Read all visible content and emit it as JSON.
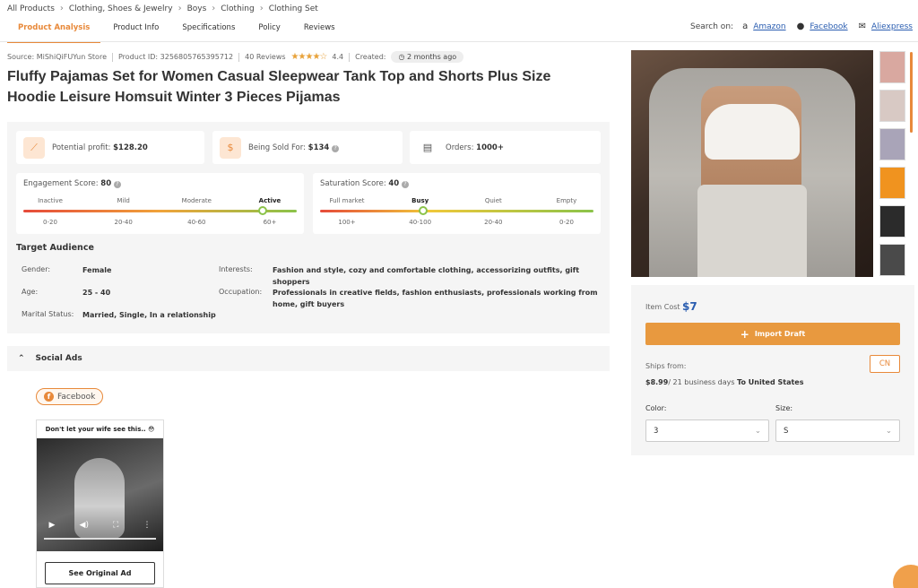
{
  "breadcrumb": [
    "All Products",
    "Clothing, Shoes & Jewelry",
    "Boys",
    "Clothing",
    "Clothing Set"
  ],
  "tabs": [
    "Product Analysis",
    "Product Info",
    "Specifications",
    "Policy",
    "Reviews"
  ],
  "search_on": {
    "label": "Search on:",
    "links": [
      "Amazon",
      "Facebook",
      "Aliexpress"
    ]
  },
  "meta": {
    "source": "Source: MiShiQiFUYun Store",
    "product_id": "Product ID: 3256805765395712",
    "reviews": "40 Reviews",
    "rating": "4.4",
    "rating_value": 4.4,
    "created_label": "Created:",
    "created_value": "2 months ago"
  },
  "title": "Fluffy Pajamas Set for Women Casual Sleepwear Tank Top and Shorts Plus Size Hoodie Leisure Homsuit Winter 3 Pieces Pijamas",
  "metrics": {
    "profit_label": "Potential profit:",
    "profit_value": "$128.20",
    "sold_label": "Being Sold For:",
    "sold_value": "$134",
    "orders_label": "Orders:",
    "orders_value": "1000+"
  },
  "engagement": {
    "label": "Engagement Score:",
    "value": "80",
    "score": 80,
    "levels": [
      "Inactive",
      "Mild",
      "Moderate",
      "Active"
    ],
    "ranges": [
      "0-20",
      "20-40",
      "40-60",
      "60+"
    ],
    "active_index": 3
  },
  "saturation": {
    "label": "Saturation Score:",
    "value": "40",
    "score": 40,
    "levels": [
      "Full market",
      "Busy",
      "Quiet",
      "Empty"
    ],
    "ranges": [
      "100+",
      "40-100",
      "20-40",
      "0-20"
    ],
    "active_index": 1
  },
  "audience": {
    "title": "Target Audience",
    "gender_label": "Gender:",
    "gender": "Female",
    "age_label": "Age:",
    "age": "25 - 40",
    "marital_label": "Marital Status:",
    "marital": "Married, Single, In a relationship",
    "interests_label": "Interests:",
    "interests": "Fashion and style, cozy and comfortable clothing, accessorizing outfits, gift shoppers",
    "occupation_label": "Occupation:",
    "occupation": "Professionals in creative fields, fashion enthusiasts, professionals working from home, gift buyers"
  },
  "social": {
    "title": "Social Ads",
    "platform": "Facebook",
    "ad_caption": "Don't let your wife see this.. 😳",
    "see_original": "See Original Ad"
  },
  "side": {
    "item_cost_label": "Item Cost",
    "item_cost": "$7",
    "import_btn": "Import Draft",
    "ships_from_label": "Ships from:",
    "cn": "CN",
    "ship_price": "$8.99",
    "ship_days": "/ 21 business days",
    "ship_to": "To United States",
    "color_label": "Color:",
    "color_value": "3",
    "size_label": "Size:",
    "size_value": "S"
  },
  "colors": {
    "accent": "#e8893a",
    "link": "#2a5db0"
  },
  "thumbnails": [
    {
      "color": "#d9a8a0"
    },
    {
      "color": "#d8c9c4"
    },
    {
      "color": "#a9a4b8"
    },
    {
      "color": "#f0931f"
    },
    {
      "color": "#2b2b2b"
    },
    {
      "color": "#4a4a4a"
    }
  ]
}
